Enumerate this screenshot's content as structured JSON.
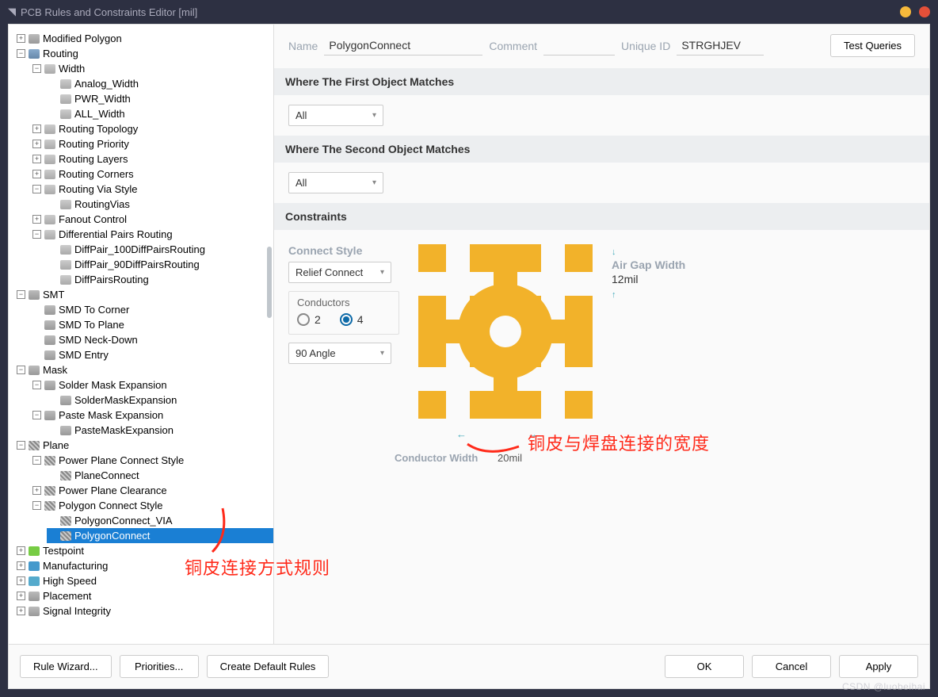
{
  "window": {
    "title": "PCB Rules and Constraints Editor [mil]"
  },
  "tree": {
    "modified_polygon": "Modified Polygon",
    "routing": "Routing",
    "width": "Width",
    "analog_width": "Analog_Width",
    "pwr_width": "PWR_Width",
    "all_width": "ALL_Width",
    "routing_topology": "Routing Topology",
    "routing_priority": "Routing Priority",
    "routing_layers": "Routing Layers",
    "routing_corners": "Routing Corners",
    "routing_via_style": "Routing Via Style",
    "routing_vias": "RoutingVias",
    "fanout_control": "Fanout Control",
    "diff_pairs_routing": "Differential Pairs Routing",
    "diff100": "DiffPair_100DiffPairsRouting",
    "diff90": "DiffPair_90DiffPairsRouting",
    "diffpairs": "DiffPairsRouting",
    "smt": "SMT",
    "smd_corner": "SMD To Corner",
    "smd_plane": "SMD To Plane",
    "smd_neck": "SMD Neck-Down",
    "smd_entry": "SMD Entry",
    "mask": "Mask",
    "solder_mask_exp": "Solder Mask Expansion",
    "solder_mask_exp_r": "SolderMaskExpansion",
    "paste_mask_exp": "Paste Mask Expansion",
    "paste_mask_exp_r": "PasteMaskExpansion",
    "plane": "Plane",
    "power_plane_connect": "Power Plane Connect Style",
    "plane_connect": "PlaneConnect",
    "power_plane_clearance": "Power Plane Clearance",
    "polygon_connect_style": "Polygon Connect Style",
    "polygon_connect_via": "PolygonConnect_VIA",
    "polygon_connect": "PolygonConnect",
    "testpoint": "Testpoint",
    "manufacturing": "Manufacturing",
    "high_speed": "High Speed",
    "placement": "Placement",
    "signal_integrity": "Signal Integrity"
  },
  "header": {
    "name_lbl": "Name",
    "name_val": "PolygonConnect",
    "comment_lbl": "Comment",
    "comment_val": "",
    "uid_lbl": "Unique ID",
    "uid_val": "STRGHJEV",
    "test_queries": "Test Queries"
  },
  "sections": {
    "where_first": "Where The First Object Matches",
    "where_second": "Where The Second Object Matches",
    "constraints": "Constraints"
  },
  "match": {
    "first": "All",
    "second": "All"
  },
  "constraints": {
    "connect_style_lbl": "Connect Style",
    "connect_style_val": "Relief Connect",
    "conductors_lbl": "Conductors",
    "radio2": "2",
    "radio4": "4",
    "angle_val": "90 Angle",
    "air_gap_lbl": "Air Gap Width",
    "air_gap_val": "12mil",
    "cond_width_lbl": "Conductor Width",
    "cond_width_val": "20mil"
  },
  "annotations": {
    "connect_rule": "铜皮连接方式规则",
    "copper_pad_width": "铜皮与焊盘连接的宽度"
  },
  "footer": {
    "rule_wizard": "Rule Wizard...",
    "priorities": "Priorities...",
    "create_default": "Create Default Rules",
    "ok": "OK",
    "cancel": "Cancel",
    "apply": "Apply"
  },
  "watermark": "CSDN @luobeihai"
}
